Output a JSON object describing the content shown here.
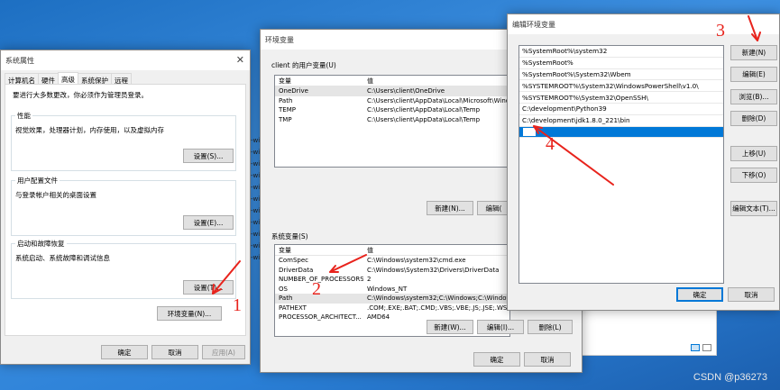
{
  "system_properties": {
    "title": "系统属性",
    "tabs": [
      "计算机名",
      "硬件",
      "高级",
      "系统保护",
      "远程"
    ],
    "active_tab": "高级",
    "admin_note": "要进行大多数更改，你必须作为管理员登录。",
    "performance": {
      "label": "性能",
      "desc": "视觉效果，处理器计划，内存使用，以及虚拟内存",
      "button": "设置(S)..."
    },
    "user_profiles": {
      "label": "用户配置文件",
      "desc": "与登录帐户相关的桌面设置",
      "button": "设置(E)..."
    },
    "startup_recovery": {
      "label": "启动和故障恢复",
      "desc": "系统启动、系统故障和调试信息",
      "button": "设置(T)..."
    },
    "env_button": "环境变量(N)...",
    "ok": "确定",
    "cancel": "取消",
    "apply": "应用(A)"
  },
  "env_vars": {
    "title": "环境变量",
    "user_section_label": "client 的用户变量(U)",
    "col_var": "变量",
    "col_val": "值",
    "user_vars": [
      {
        "name": "OneDrive",
        "value": "C:\\Users\\client\\OneDrive"
      },
      {
        "name": "Path",
        "value": "C:\\Users\\client\\AppData\\Local\\Microsoft\\Windo"
      },
      {
        "name": "TEMP",
        "value": "C:\\Users\\client\\AppData\\Local\\Temp"
      },
      {
        "name": "TMP",
        "value": "C:\\Users\\client\\AppData\\Local\\Temp"
      }
    ],
    "user_new": "新建(N)...",
    "user_edit": "编辑(",
    "system_section_label": "系统变量(S)",
    "system_vars": [
      {
        "name": "ComSpec",
        "value": "C:\\Windows\\system32\\cmd.exe"
      },
      {
        "name": "DriverData",
        "value": "C:\\Windows\\System32\\Drivers\\DriverData"
      },
      {
        "name": "NUMBER_OF_PROCESSORS",
        "value": "2"
      },
      {
        "name": "OS",
        "value": "Windows_NT"
      },
      {
        "name": "Path",
        "value": "C:\\Windows\\system32;C:\\Windows;C:\\Windows"
      },
      {
        "name": "PATHEXT",
        "value": ".COM;.EXE;.BAT;.CMD;.VBS;.VBE;.JS;.JSE;.WSF;.W"
      },
      {
        "name": "PROCESSOR_ARCHITECT...",
        "value": "AMD64"
      }
    ],
    "sys_new": "新建(W)...",
    "sys_edit": "编辑(I)...",
    "sys_delete": "删除(L)",
    "ok": "确定",
    "cancel": "取消"
  },
  "edit_env": {
    "title": "编辑环境变量",
    "paths": [
      "%SystemRoot%\\system32",
      "%SystemRoot%",
      "%SystemRoot%\\System32\\Wbem",
      "%SYSTEMROOT%\\System32\\WindowsPowerShell\\v1.0\\",
      "%SYSTEMROOT%\\System32\\OpenSSH\\",
      "C:\\development\\Python39",
      "C:\\development\\jdk1.8.0_221\\bin"
    ],
    "buttons": {
      "new": "新建(N)",
      "edit": "编辑(E)",
      "browse": "浏览(B)...",
      "delete": "删除(D)",
      "up": "上移(U)",
      "down": "下移(O)",
      "edit_text": "编辑文本(T)..."
    },
    "ok": "确定",
    "cancel": "取消"
  },
  "background_text": [
    "-wir",
    "-wir",
    "-wir",
    "-wir",
    "-wir",
    "-wir",
    "-wir",
    "-wir",
    "-wir",
    "-wir",
    "-wir"
  ],
  "annotations": [
    "1",
    "2",
    "3",
    "4"
  ],
  "watermark": "CSDN @p36273",
  "colors": {
    "selection": "#0078d7",
    "arrow": "#e8231c"
  }
}
